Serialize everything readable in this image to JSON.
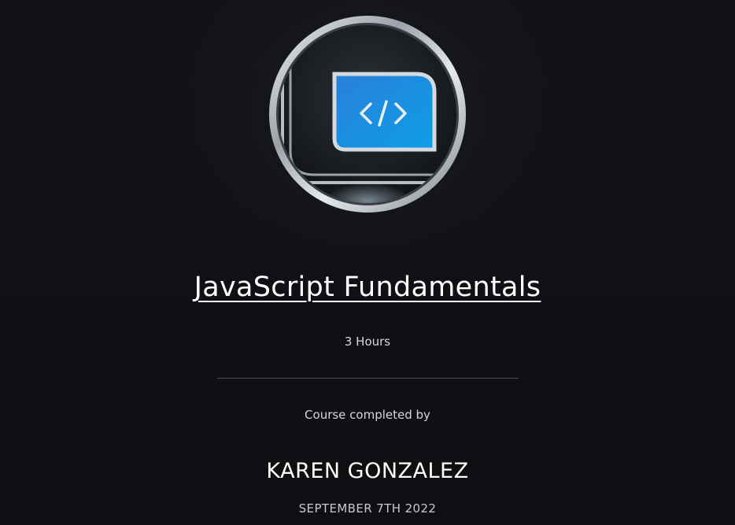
{
  "badge": {
    "icon": "code-brackets-icon",
    "accent_color": "#1f7fd6"
  },
  "course": {
    "title": "JavaScript Fundamentals",
    "duration": "3 Hours"
  },
  "completion": {
    "label": "Course completed by",
    "recipient": "KAREN GONZALEZ",
    "date": "SEPTEMBER 7TH 2022"
  }
}
